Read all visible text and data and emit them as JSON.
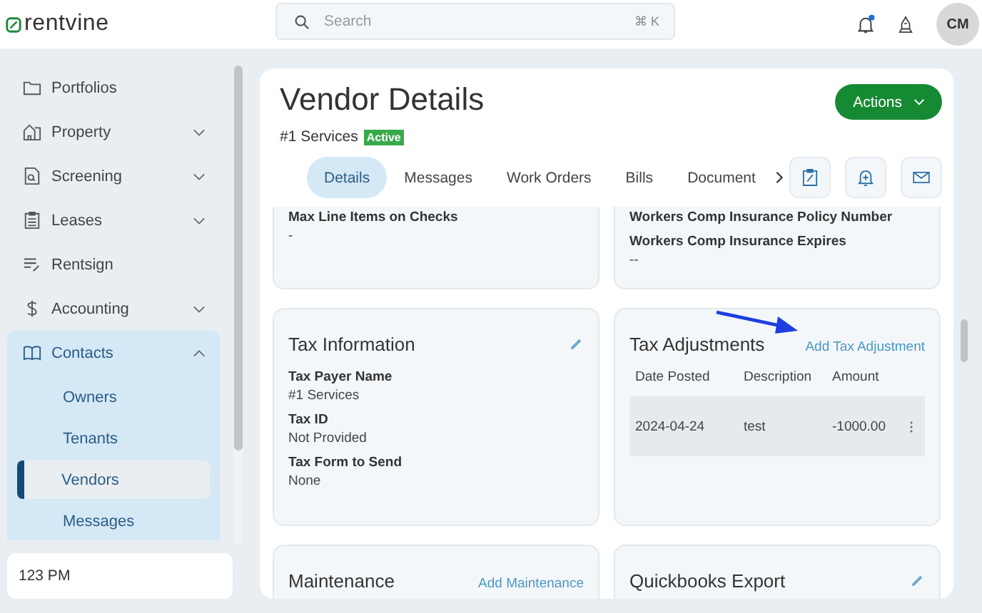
{
  "header": {
    "logo": "rentvine",
    "search": {
      "placeholder": "Search",
      "shortcut": "⌘ K"
    },
    "notification_unread": true,
    "avatar": "CM"
  },
  "sidebar": {
    "items": [
      {
        "label": "Portfolios",
        "kind": "folder",
        "has_submenu": false,
        "expanded": false
      },
      {
        "label": "Property",
        "kind": "building",
        "has_submenu": true,
        "expanded": false
      },
      {
        "label": "Screening",
        "kind": "document",
        "has_submenu": true,
        "expanded": false
      },
      {
        "label": "Leases",
        "kind": "clipboard",
        "has_submenu": true,
        "expanded": false
      },
      {
        "label": "Rentsign",
        "kind": "sign",
        "has_submenu": false,
        "expanded": false
      },
      {
        "label": "Accounting",
        "kind": "dollar",
        "has_submenu": true,
        "expanded": false
      },
      {
        "label": "Contacts",
        "kind": "book",
        "has_submenu": true,
        "expanded": true,
        "children": [
          {
            "label": "Owners",
            "selected": false
          },
          {
            "label": "Tenants",
            "selected": false
          },
          {
            "label": "Vendors",
            "selected": true
          },
          {
            "label": "Messages",
            "selected": false
          }
        ]
      }
    ],
    "footer": "123 PM"
  },
  "main": {
    "title": "Vendor Details",
    "actions_button": "Actions",
    "vendor_name": "#1 Services",
    "status": "Active",
    "tabs": [
      {
        "label": "Details",
        "selected": true
      },
      {
        "label": "Messages",
        "selected": false
      },
      {
        "label": "Work Orders",
        "selected": false
      },
      {
        "label": "Bills",
        "selected": false
      },
      {
        "label": "Document",
        "selected": false
      }
    ],
    "cards": [
      {
        "kind": "fields",
        "fields": [
          {
            "label": "Max Line Items on Checks",
            "value": "-"
          }
        ]
      },
      {
        "kind": "fields",
        "fields": [
          {
            "label": "Workers Comp Insurance Policy Number"
          },
          {
            "label": "Workers Comp Insurance Expires",
            "value": "--"
          }
        ]
      },
      {
        "kind": "fields",
        "title": "Tax Information",
        "editable": true,
        "fields": [
          {
            "label": "Tax Payer Name",
            "value": "#1 Services"
          },
          {
            "label": "Tax ID",
            "value": "Not Provided"
          },
          {
            "label": "Tax Form to Send",
            "value": "None"
          }
        ]
      },
      {
        "kind": "table",
        "title": "Tax Adjustments",
        "link": "Add Tax Adjustment",
        "annotated": true,
        "columns": [
          "Date Posted",
          "Description",
          "Amount"
        ],
        "rows": [
          [
            "2024-04-24",
            "test",
            "-1000.00"
          ]
        ]
      },
      {
        "kind": "fields",
        "title": "Maintenance",
        "link": "Add Maintenance"
      },
      {
        "kind": "fields",
        "title": "Quickbooks Export",
        "editable": true
      }
    ]
  }
}
